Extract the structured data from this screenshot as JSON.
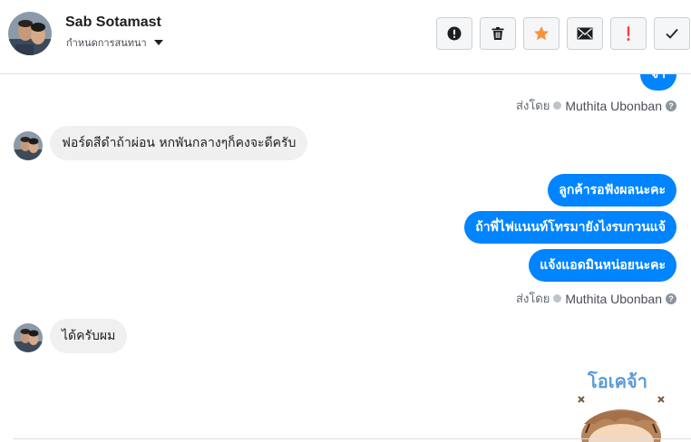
{
  "header": {
    "contact_name": "Sab Sotamast",
    "assign_label": "กำหนดการสนทนา"
  },
  "toolbar": {
    "buttons": [
      {
        "name": "mark-spam",
        "icon": "alert-circle-icon"
      },
      {
        "name": "delete",
        "icon": "trash-icon"
      },
      {
        "name": "star",
        "icon": "star-icon"
      },
      {
        "name": "mark-unread",
        "icon": "envelope-icon"
      },
      {
        "name": "mark-important",
        "icon": "exclamation-icon"
      },
      {
        "name": "mark-done",
        "icon": "checkmark-icon"
      }
    ],
    "colors": {
      "star": "#f7923b",
      "important": "#fa3e3e"
    }
  },
  "conversation": {
    "partial_outgoing": "จ้า",
    "sent_by_1": {
      "label": "ส่งโดย",
      "agent": "Muthita Ubonban"
    },
    "incoming_1": "ฟอร์ดสีดำถ้าผ่อน หกพันกลางๆก็คงจะดีครับ",
    "outgoing": [
      "ลูกค้ารอฟังผลนะคะ",
      "ถ้าพี่ไฟแนนท์โทรมายังไงรบกวนแจ้",
      "แจ้งแอดมินหน่อยนะคะ"
    ],
    "sent_by_2": {
      "label": "ส่งโดย",
      "agent": "Muthita Ubonban"
    },
    "incoming_2": "ได้ครับผม",
    "sticker_text": "โอเคจ้า"
  },
  "colors": {
    "accent": "#0084ff",
    "bubble_in": "#f1f0f0"
  }
}
